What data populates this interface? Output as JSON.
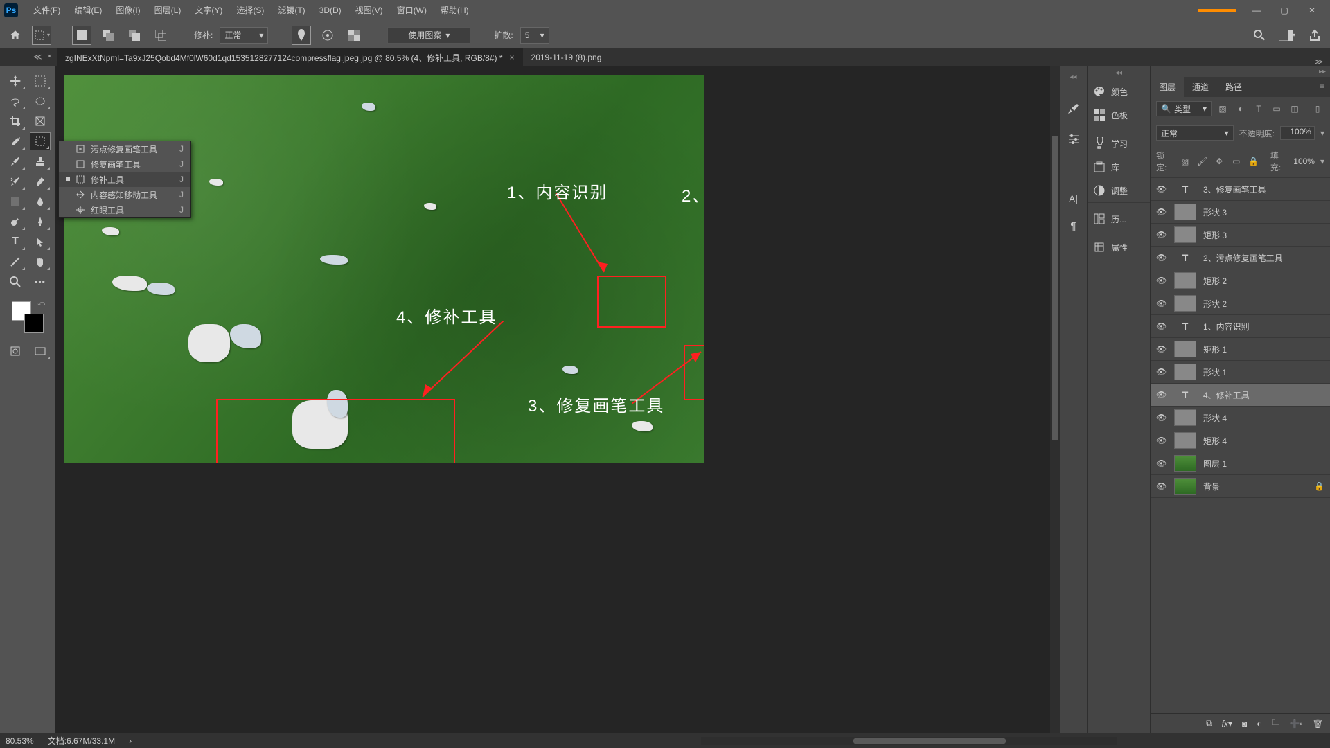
{
  "menubar": {
    "logo": "Ps",
    "items": [
      "文件(F)",
      "编辑(E)",
      "图像(I)",
      "图层(L)",
      "文字(Y)",
      "选择(S)",
      "滤镜(T)",
      "3D(D)",
      "视图(V)",
      "窗口(W)",
      "帮助(H)"
    ]
  },
  "optbar": {
    "patch_label": "修补:",
    "patch_mode": "正常",
    "use_pattern": "使用图案",
    "diffuse_label": "扩散:",
    "diffuse_value": "5"
  },
  "tabs": {
    "tab1": "zgINExXtNpml=Ta9xJ25Qobd4Mf0lW60d1qd1535128277124compressflag.jpeg.jpg  @  80.5% (4、修补工具, RGB/8#) *",
    "tab2": "2019-11-19 (8).png"
  },
  "flyout": {
    "items": [
      {
        "label": "污点修复画笔工具",
        "key": "J"
      },
      {
        "label": "修复画笔工具",
        "key": "J"
      },
      {
        "label": "修补工具",
        "key": "J"
      },
      {
        "label": "内容感知移动工具",
        "key": "J"
      },
      {
        "label": "红眼工具",
        "key": "J"
      }
    ]
  },
  "annotations": {
    "a1": "1、内容识别",
    "a2": "2、",
    "a3": "3、修复画笔工具",
    "a4": "4、修补工具"
  },
  "mid_panels": {
    "color": "颜色",
    "swatches": "色板",
    "learn": "学习",
    "library": "库",
    "adjust": "调整",
    "history": "历...",
    "properties": "属性"
  },
  "layers_panel": {
    "tabs": {
      "layers": "图层",
      "channels": "通道",
      "paths": "路径"
    },
    "filter_label": "类型",
    "blend_mode": "正常",
    "opacity_label": "不透明度:",
    "opacity_value": "100%",
    "lock_label": "锁定:",
    "fill_label": "填充:",
    "fill_value": "100%",
    "layers": [
      {
        "type": "txt",
        "name": "3、修复画笔工具"
      },
      {
        "type": "shape",
        "name": "形状 3"
      },
      {
        "type": "shape",
        "name": "矩形 3"
      },
      {
        "type": "txt",
        "name": "2、污点修复画笔工具"
      },
      {
        "type": "shape",
        "name": "矩形 2"
      },
      {
        "type": "shape",
        "name": "形状 2"
      },
      {
        "type": "txt",
        "name": "1、内容识别"
      },
      {
        "type": "shape",
        "name": "矩形 1"
      },
      {
        "type": "shape",
        "name": "形状 1"
      },
      {
        "type": "txt",
        "name": "4、修补工具",
        "sel": true
      },
      {
        "type": "shape",
        "name": "形状 4"
      },
      {
        "type": "shape",
        "name": "矩形 4"
      },
      {
        "type": "img",
        "name": "图层 1"
      },
      {
        "type": "img",
        "name": "背景",
        "locked": true
      }
    ]
  },
  "status": {
    "zoom": "80.53%",
    "docinfo": "文档:6.67M/33.1M"
  }
}
